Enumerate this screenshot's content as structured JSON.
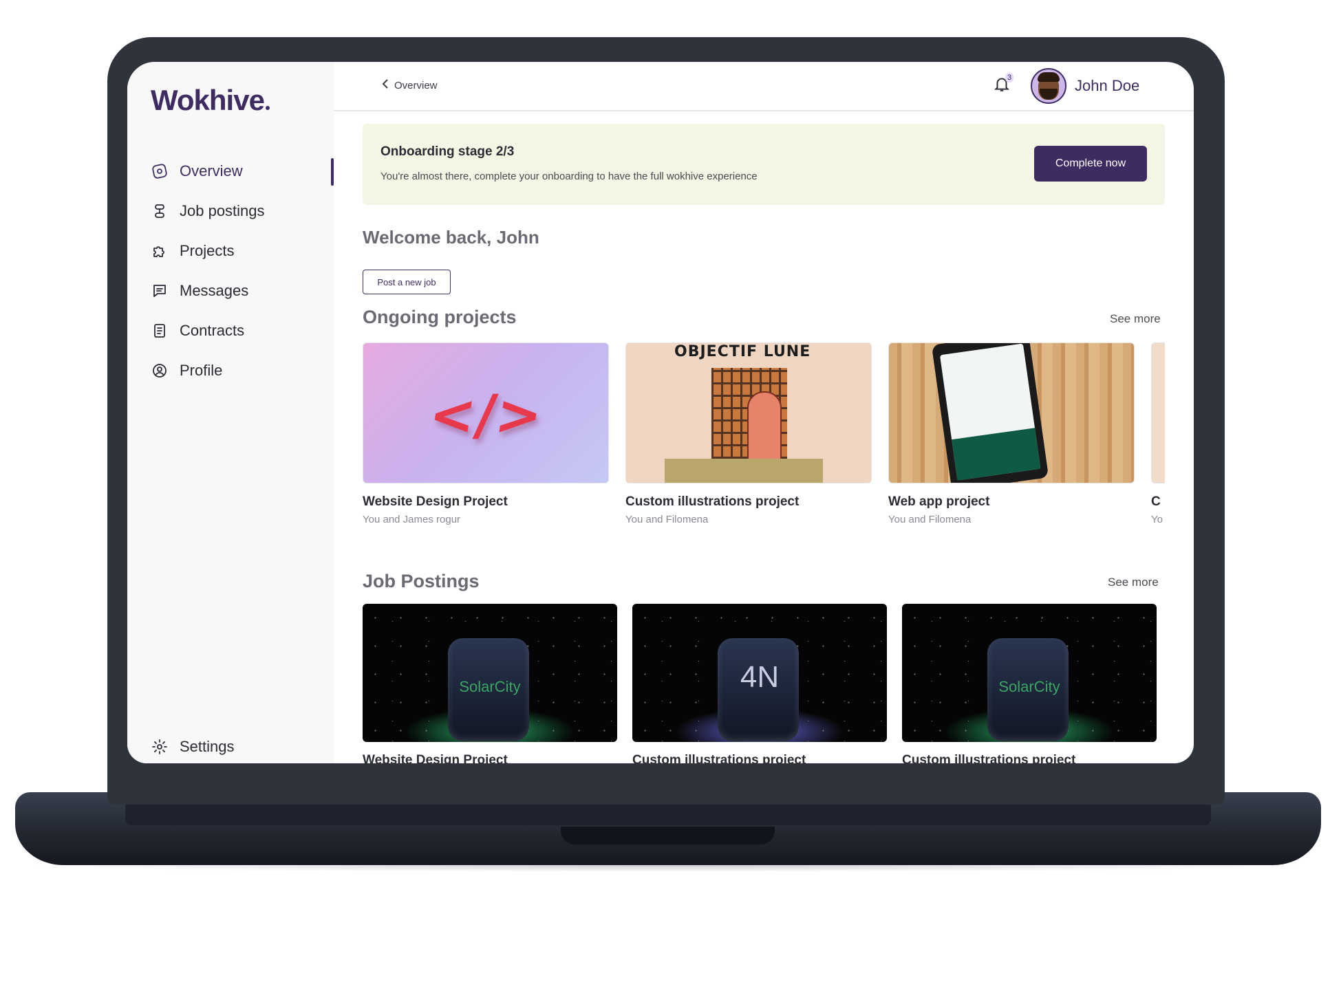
{
  "app": {
    "logo": "Wokhive"
  },
  "sidebar": {
    "items": [
      {
        "label": "Overview",
        "icon": "compass-icon",
        "active": true
      },
      {
        "label": "Job postings",
        "icon": "job-postings-icon",
        "active": false
      },
      {
        "label": "Projects",
        "icon": "puzzle-icon",
        "active": false
      },
      {
        "label": "Messages",
        "icon": "message-icon",
        "active": false
      },
      {
        "label": "Contracts",
        "icon": "document-icon",
        "active": false
      },
      {
        "label": "Profile",
        "icon": "user-circle-icon",
        "active": false
      }
    ],
    "settings_label": "Settings"
  },
  "header": {
    "breadcrumb": "Overview",
    "notification_count": "3",
    "user_name": "John Doe"
  },
  "banner": {
    "title": "Onboarding stage 2/3",
    "text": "You're almost there, complete your onboarding to have the full wokhive experience",
    "button": "Complete now"
  },
  "welcome": "Welcome back, John",
  "post_job_button": "Post a new job",
  "ongoing": {
    "title": "Ongoing projects",
    "see_more": "See more",
    "projects": [
      {
        "title": "Website Design Project",
        "subtitle": "You and James rogur"
      },
      {
        "title": "Custom illustrations project",
        "subtitle": "You and Filomena",
        "image_text": "OBJECTIF LUNE"
      },
      {
        "title": "Web app project",
        "subtitle": "You and Filomena"
      },
      {
        "title": "C",
        "subtitle": "Yo"
      }
    ]
  },
  "jobs": {
    "title": "Job Postings",
    "see_more": "See more",
    "postings": [
      {
        "title": "Website Design Project",
        "brand": "SolarCity"
      },
      {
        "title": "Custom illustrations project",
        "brand": "4N"
      },
      {
        "title": "Custom illustrations project",
        "brand": "SolarCity"
      }
    ]
  },
  "colors": {
    "primary": "#3d2b61",
    "banner_bg": "#f4f5e4",
    "frame": "#2f333c"
  }
}
